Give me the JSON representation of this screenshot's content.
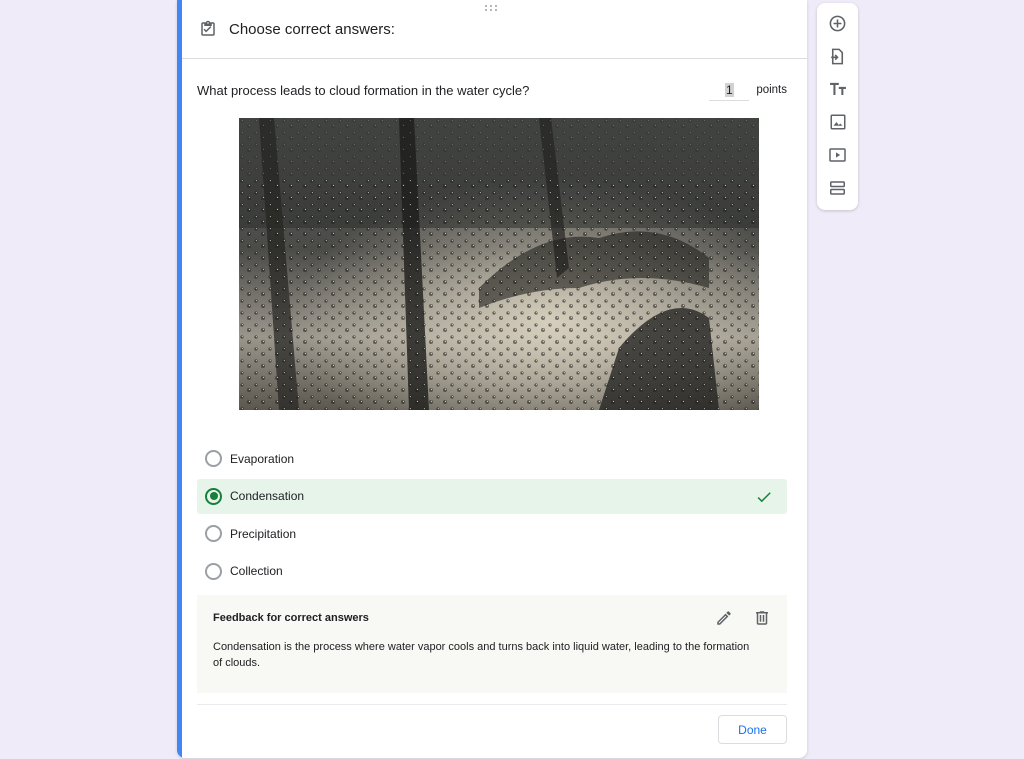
{
  "header": {
    "title": "Choose correct answers:",
    "icon": "checkbox-checked-icon"
  },
  "question": {
    "text": "What process leads to cloud formation in the water cycle?",
    "points_value": "1",
    "points_label": "points"
  },
  "image": {
    "subject": "raindrops-on-window-photo"
  },
  "options": [
    {
      "label": "Evaporation",
      "correct": false
    },
    {
      "label": "Condensation",
      "correct": true
    },
    {
      "label": "Precipitation",
      "correct": false
    },
    {
      "label": "Collection",
      "correct": false
    }
  ],
  "feedback": {
    "title": "Feedback for correct answers",
    "text": "Condensation is the process where water vapor cools and turns back into liquid water, leading to the formation of clouds."
  },
  "done_label": "Done",
  "toolbar": {
    "items": [
      "add-question-icon",
      "import-questions-icon",
      "add-title-icon",
      "add-image-icon",
      "add-video-icon",
      "add-section-icon"
    ]
  },
  "colors": {
    "background": "#f0ebf8",
    "accent": "#4285f4",
    "correct": "#188038",
    "correct_bg": "#e6f4ea",
    "done_text": "#1a73e8"
  }
}
